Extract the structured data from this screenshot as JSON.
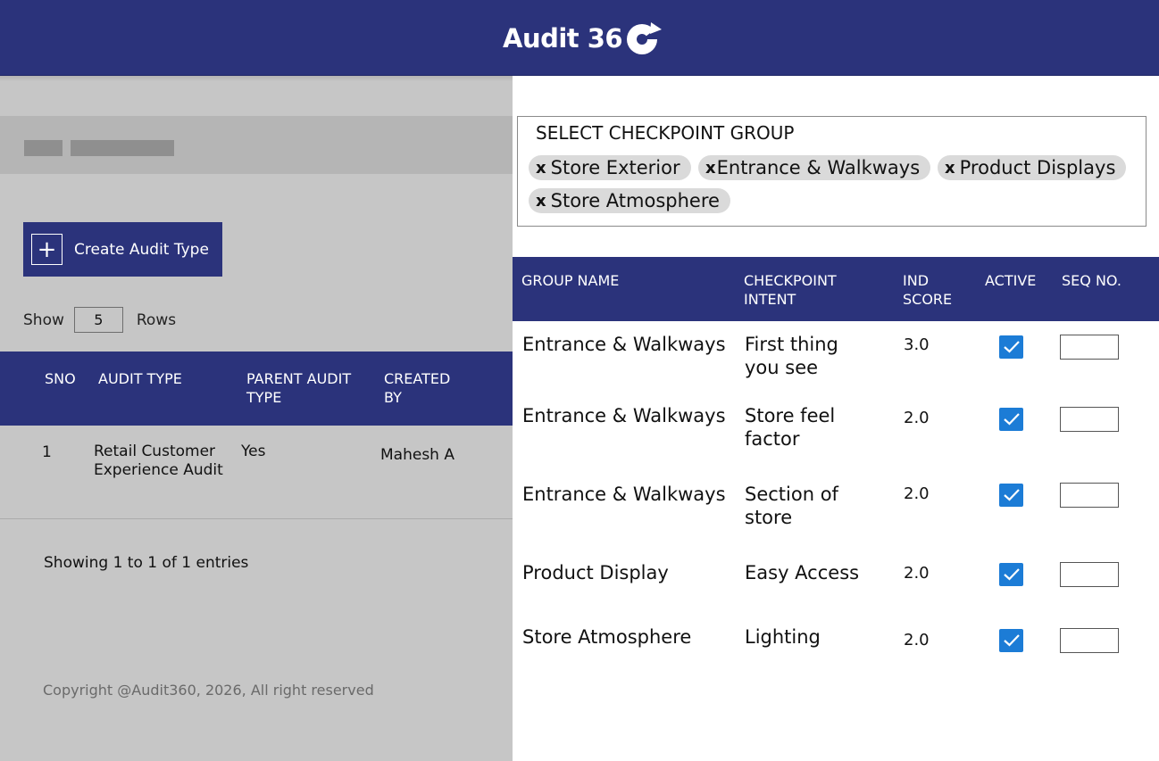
{
  "header": {
    "brand": "Audit 36",
    "logo_icon": "refresh-o-icon",
    "color": "#2b337b"
  },
  "left": {
    "create_button": {
      "label": "Create Audit Type",
      "icon": "plus-icon"
    },
    "show": {
      "prefix": "Show",
      "value": "5",
      "suffix": "Rows"
    },
    "table": {
      "columns": [
        "SNO",
        "AUDIT TYPE",
        "PARENT AUDIT TYPE",
        "CREATED BY"
      ],
      "rows": [
        {
          "sno": "1",
          "audit_type": "Retail Customer Experience Audit",
          "parent": "Yes",
          "created_by": "Mahesh A"
        }
      ]
    },
    "entries_text": "Showing 1 to 1 of 1 entries",
    "copyright": "Copyright @Audit360, 2026, All right reserved"
  },
  "checkpoint_group": {
    "title": "SELECT CHECKPOINT GROUP",
    "remove_symbol": "x",
    "chips": [
      "Store Exterior",
      "Entrance & Walkways",
      "Product Displays",
      "Store Atmosphere"
    ]
  },
  "right_table": {
    "columns": [
      "GROUP NAME",
      "CHECKPOINT INTENT",
      "IND SCORE",
      "ACTIVE",
      "SEQ NO."
    ],
    "rows": [
      {
        "group": "Entrance & Walkways",
        "intent": "First thing you see",
        "score": "3.0",
        "active": true,
        "seq": ""
      },
      {
        "group": "Entrance & Walkways",
        "intent": "Store feel factor",
        "score": "2.0",
        "active": true,
        "seq": ""
      },
      {
        "group": "Entrance & Walkways",
        "intent": "Section of store",
        "score": "2.0",
        "active": true,
        "seq": ""
      },
      {
        "group": "Product Display",
        "intent": "Easy Access",
        "score": "2.0",
        "active": true,
        "seq": ""
      },
      {
        "group": "Store Atmosphere",
        "intent": "Lighting",
        "score": "2.0",
        "active": true,
        "seq": ""
      }
    ]
  },
  "colors": {
    "primary": "#2b337b",
    "checkbox": "#1c7cd6",
    "panel_gray": "#c6c6c6",
    "chip": "#dadada"
  }
}
